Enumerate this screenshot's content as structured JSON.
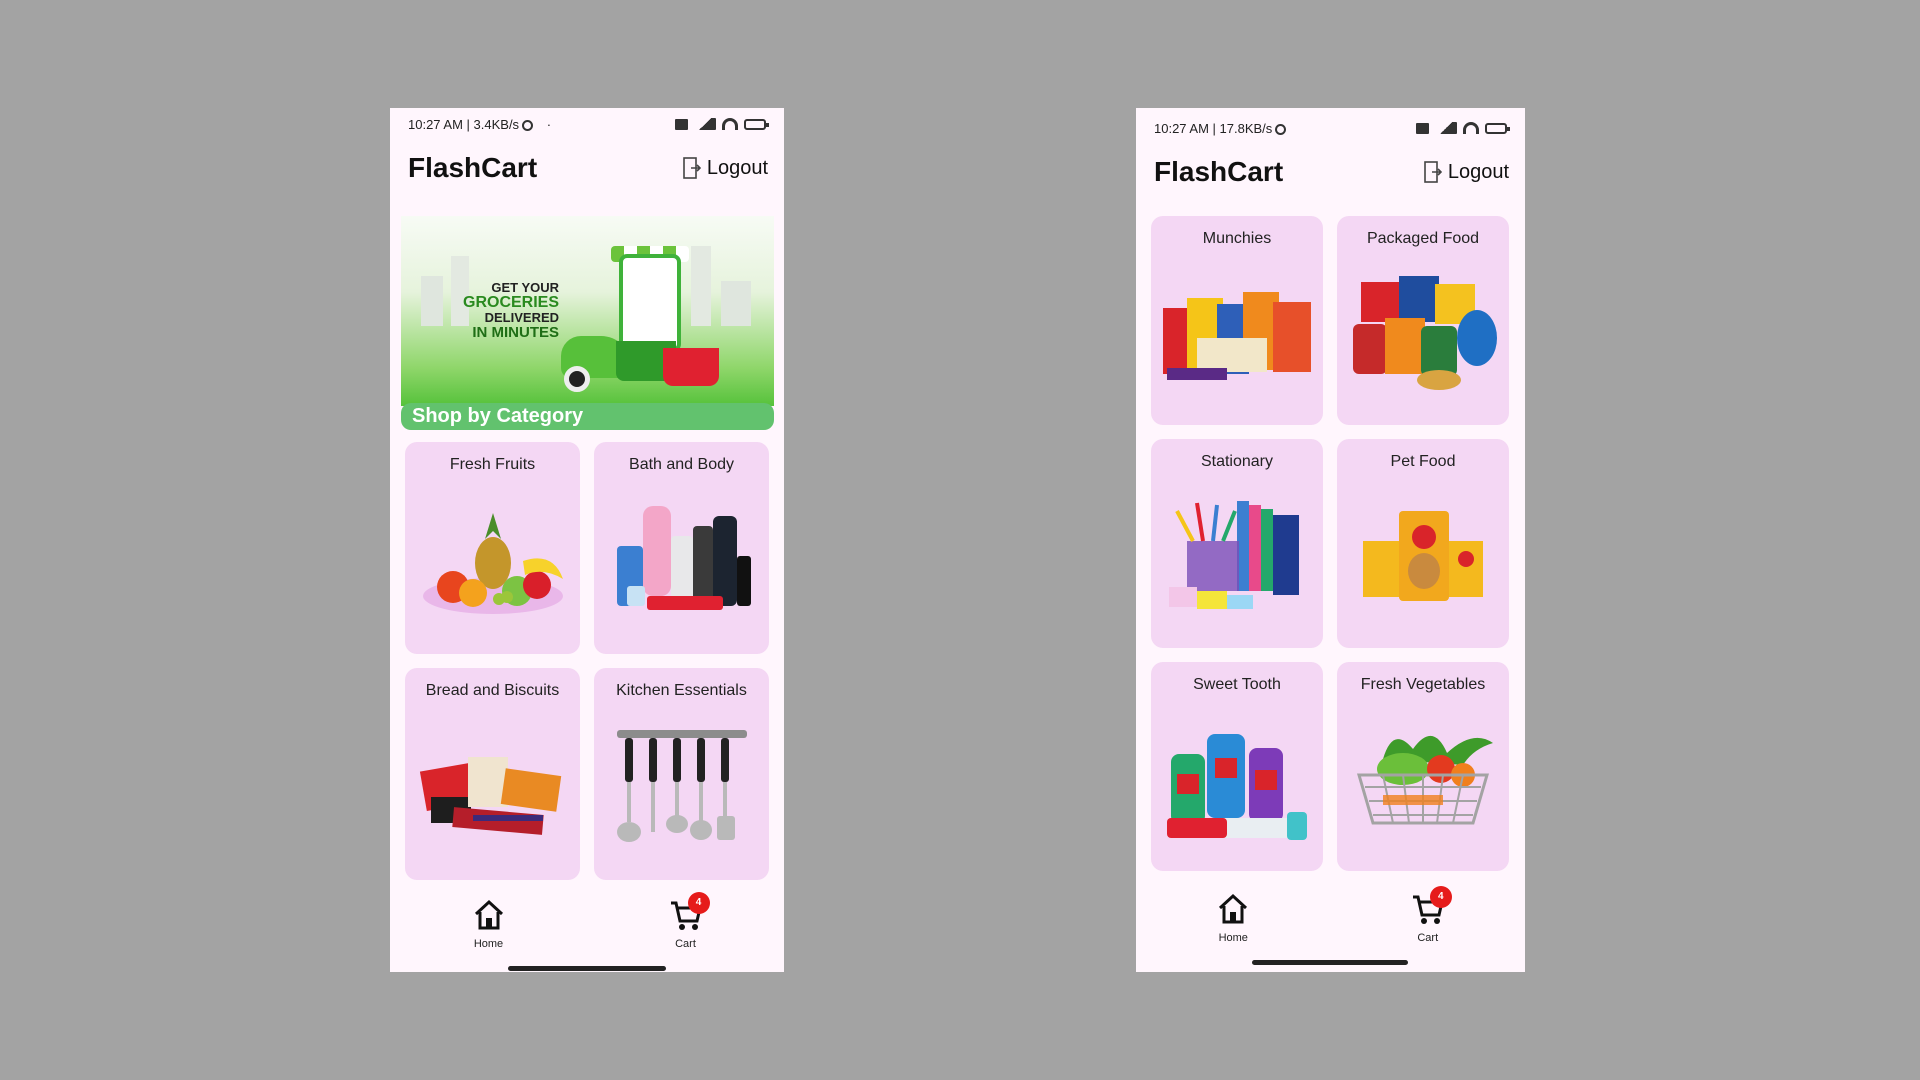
{
  "left_screen": {
    "status": {
      "time": "10:27 AM | 3.4KB/s",
      "dot": "·",
      "battery": "2"
    },
    "header": {
      "title": "FlashCart",
      "logout_label": "Logout"
    },
    "banner": {
      "line1": "GET YOUR",
      "line2": "GROCERIES",
      "line3": "DELIVERED",
      "line4": "IN MINUTES"
    },
    "section_label": "Shop by Category",
    "categories": [
      {
        "label": "Fresh Fruits",
        "icon": "fruits-image"
      },
      {
        "label": "Bath and Body",
        "icon": "bath-body-image"
      },
      {
        "label": "Bread and Biscuits",
        "icon": "bread-biscuits-image"
      },
      {
        "label": "Kitchen Essentials",
        "icon": "kitchen-utensils-image"
      }
    ],
    "nav": {
      "home_label": "Home",
      "cart_label": "Cart",
      "cart_badge": "4"
    }
  },
  "right_screen": {
    "status": {
      "time": "10:27 AM | 17.8KB/s",
      "battery": "2"
    },
    "header": {
      "title": "FlashCart",
      "logout_label": "Logout"
    },
    "categories": [
      {
        "label": "Munchies",
        "icon": "munchies-image"
      },
      {
        "label": "Packaged Food",
        "icon": "packaged-food-image"
      },
      {
        "label": "Stationary",
        "icon": "stationary-image"
      },
      {
        "label": "Pet Food",
        "icon": "pet-food-image"
      },
      {
        "label": "Sweet Tooth",
        "icon": "sweet-tooth-image"
      },
      {
        "label": "Fresh Vegetables",
        "icon": "vegetables-basket-image"
      }
    ],
    "nav": {
      "home_label": "Home",
      "cart_label": "Cart",
      "cart_badge": "4"
    }
  },
  "colors": {
    "background": "#a3a3a3",
    "screen": "#fff6fd",
    "card": "#f4d7f4",
    "section_label": "#62c26e",
    "badge": "#e61b1b"
  }
}
